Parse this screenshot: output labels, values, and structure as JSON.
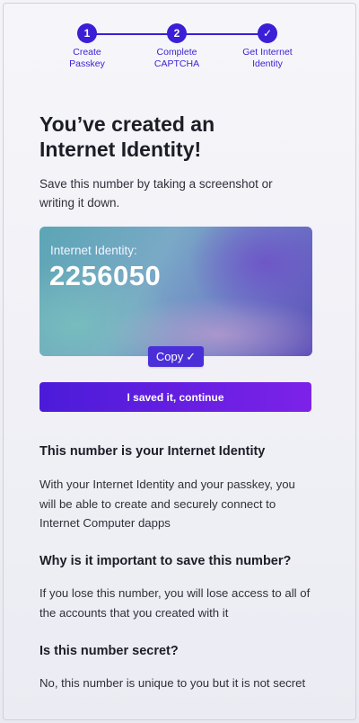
{
  "stepper": {
    "steps": [
      {
        "marker": "1",
        "label": "Create\nPasskey"
      },
      {
        "marker": "2",
        "label": "Complete\nCAPTCHA"
      },
      {
        "marker": "✓",
        "label": "Get Internet\nIdentity"
      }
    ]
  },
  "title": "You’ve created an Internet Identity!",
  "intro": "Save this number by taking a screenshot or writing it down.",
  "card": {
    "label": "Internet Identity:",
    "number": "2256050"
  },
  "copy_button": {
    "label": "Copy",
    "icon": "check-icon",
    "check": "✓"
  },
  "continue_button": {
    "label": "I saved it, continue"
  },
  "sections": [
    {
      "title": "This number is your Internet Identity",
      "body": "With your Internet Identity and your passkey, you will be able to create and securely connect to Internet Computer dapps"
    },
    {
      "title": "Why is it important to save this number?",
      "body": "If you lose this number, you will lose access to all of the accounts that you created with it"
    },
    {
      "title": "Is this number secret?",
      "body": "No, this number is unique to you but it is not secret"
    }
  ],
  "colors": {
    "accent": "#3b1fd6",
    "button_start": "#4b1bd9",
    "button_end": "#7d22e8"
  }
}
